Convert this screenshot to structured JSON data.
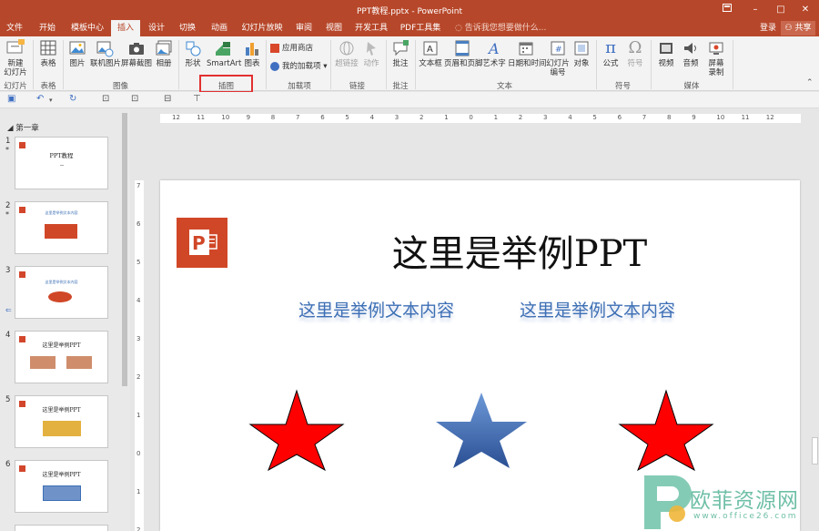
{
  "window": {
    "title": "PPT教程.pptx - PowerPoint",
    "restore_icon": "ribbon-display-icon",
    "minimize": "–",
    "maximize": "□",
    "close": "✕"
  },
  "menu": {
    "tabs": [
      "文件",
      "开始",
      "模板中心",
      "插入",
      "设计",
      "切换",
      "动画",
      "幻灯片放映",
      "审阅",
      "视图",
      "开发工具",
      "PDF工具集"
    ],
    "active_tab": "插入",
    "tell_me": "告诉我您想要做什么...",
    "login": "登录",
    "share": "共享"
  },
  "ribbon": {
    "slides": {
      "new_slide": "新建\n幻灯片",
      "group": "幻灯片"
    },
    "tables": {
      "table": "表格",
      "group": "表格"
    },
    "images": {
      "picture": "图片",
      "online_picture": "联机图片",
      "screenshot": "屏幕截图",
      "album": "相册",
      "group": "图像"
    },
    "illustrations": {
      "shapes": "形状",
      "smartart": "SmartArt",
      "chart": "图表",
      "group": "插图"
    },
    "addins": {
      "store": "应用商店",
      "my_addins": "我的加载项",
      "group": "加载项"
    },
    "links": {
      "hyperlink": "超链接",
      "action": "动作",
      "group": "链接"
    },
    "comments": {
      "comment": "批注",
      "group": "批注"
    },
    "text": {
      "textbox": "文本框",
      "header_footer": "页眉和页脚",
      "wordart": "艺术字",
      "datetime": "日期和时间",
      "slide_number": "幻灯片\n编号",
      "object": "对象",
      "group": "文本"
    },
    "symbols": {
      "equation": "公式",
      "symbol": "符号",
      "group": "符号"
    },
    "media": {
      "video": "视频",
      "audio": "音频",
      "screen_record": "屏幕\n录制",
      "group": "媒体"
    }
  },
  "thumbnails": {
    "section": "第一章",
    "items": [
      {
        "num": "1",
        "star": "*",
        "text": "PPT教程"
      },
      {
        "num": "2",
        "star": "*",
        "text": "这里是举例文本内容"
      },
      {
        "num": "3",
        "star": "",
        "text": "这里是举例文本内容"
      },
      {
        "num": "4",
        "star": "",
        "text": "这里是举例PPT"
      },
      {
        "num": "5",
        "star": "",
        "text": "这里是举例PPT"
      },
      {
        "num": "6",
        "star": "",
        "text": "这里是举例PPT"
      }
    ]
  },
  "ruler": {
    "h_labels": [
      "12",
      "11",
      "10",
      "9",
      "8",
      "7",
      "6",
      "5",
      "4",
      "3",
      "2",
      "1",
      "0",
      "1",
      "2",
      "3",
      "4",
      "5",
      "6",
      "7",
      "8",
      "9",
      "10",
      "11",
      "12"
    ],
    "v_labels": [
      "7",
      "6",
      "5",
      "4",
      "3",
      "2",
      "1",
      "0",
      "1",
      "2"
    ]
  },
  "slide": {
    "title": "这里是举例PPT",
    "sub_left": "这里是举例文本内容",
    "sub_right": "这里是举例文本内容",
    "star_colors": [
      "#ff0000",
      "#4a76c4",
      "#ff0000"
    ]
  },
  "watermark": {
    "text": "欧菲资源网",
    "url": "www.office26.com"
  },
  "colors": {
    "accent": "#b7472a",
    "ribbon_bg": "#f3f3f3",
    "highlight_box": "#e23030",
    "subtitle": "#3d6fb5"
  }
}
